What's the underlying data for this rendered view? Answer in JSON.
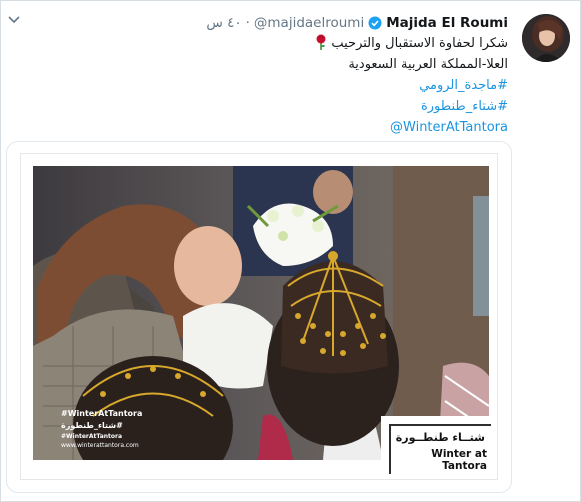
{
  "tweet": {
    "author_name": "Majida El Roumi",
    "handle": "@majidaelroumi",
    "time": "٤٠ س",
    "separator": "·",
    "text_line1": "شكرا لحفاوة الاستقبال والترحيب",
    "text_line2": "العلا-المملكة العربية السعودية",
    "hashtag1": "#ماجدة_الرومي",
    "hashtag2": "#شتاء_طنطورة",
    "mention": "@WinterAtTantora",
    "link_color": "#1b95e0",
    "verified_color": "#1da1f2"
  },
  "card": {
    "brand_ar": "شتــاء طنطــورة",
    "brand_en": "Winter at Tantora",
    "overlay_hashtag_en": "#WinterAtTantora",
    "overlay_hashtag_ar": "#شتاء_طنطورة",
    "overlay_line3": "#WinterAtTantora",
    "overlay_url": "www.winterattantora.com"
  },
  "icons": {
    "caret": "chevron-down-icon",
    "verified": "verified-badge-icon",
    "rose": "rose-emoji-icon"
  }
}
